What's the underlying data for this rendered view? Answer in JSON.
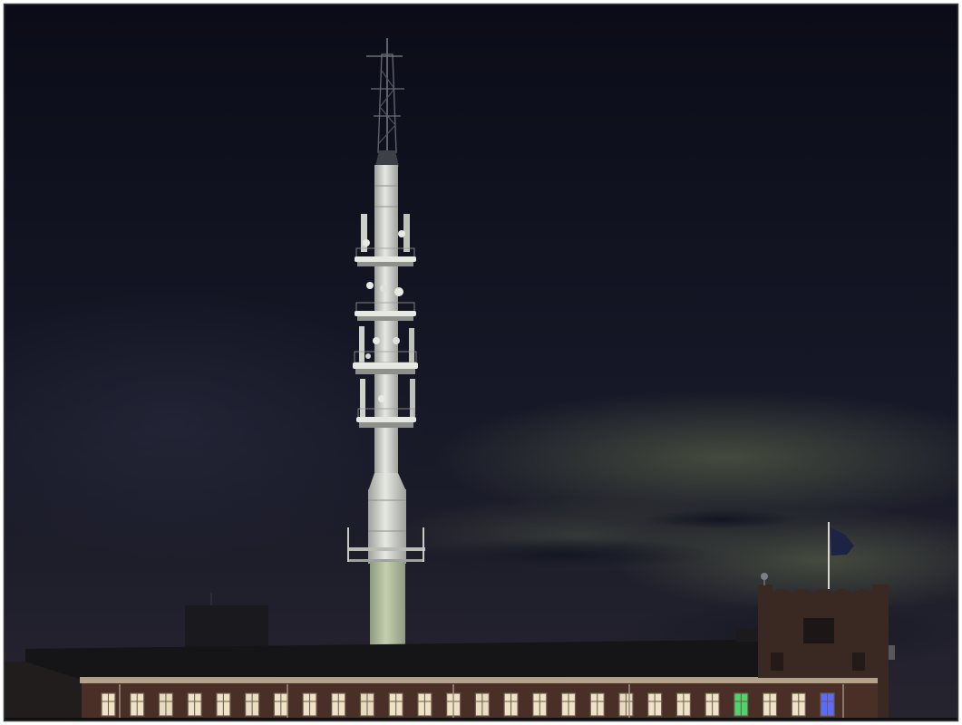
{
  "palette": {
    "frame": "#ffffff",
    "frame_border": "#3a3a3a",
    "sky_top": "#0b0c18",
    "sky_mid": "#161827",
    "sky_low": "#26242f",
    "haze": "#2b2d40",
    "cloud_glow": "#4f5643",
    "cloud_dark": "#101220",
    "tower_white": "#e6e8e2",
    "tower_shadow": "#9fa29c",
    "tower_base": "#c3cfae",
    "mast": "#5f626b",
    "roof": "#151417",
    "annex": "#221d1d",
    "brick": "#4a2f27",
    "brick_dark": "#3a2822",
    "cornice": "#c9b89c",
    "window_frame": "#6b5a50",
    "flag": "#1d2344",
    "flagpole": "#d6d6d2"
  },
  "building": {
    "window_colors": [
      "#eee3c4",
      "#eee3c4",
      "#e6dcbd",
      "#eee3c4",
      "#eee3c4",
      "#e9dfc0",
      "#eee3c4",
      "#eee3c4",
      "#eee3c4",
      "#e6dcbd",
      "#eee3c4",
      "#eee3c4",
      "#eee3c4",
      "#e9dfc0",
      "#eee3c4",
      "#eee3c4",
      "#eee3c4",
      "#eee3c4",
      "#e6dcbd",
      "#eee3c4",
      "#eee3c4",
      "#eee3c4",
      "#4fd36a",
      "#eee3c4",
      "#eee3c4",
      "#5a6cff"
    ]
  }
}
